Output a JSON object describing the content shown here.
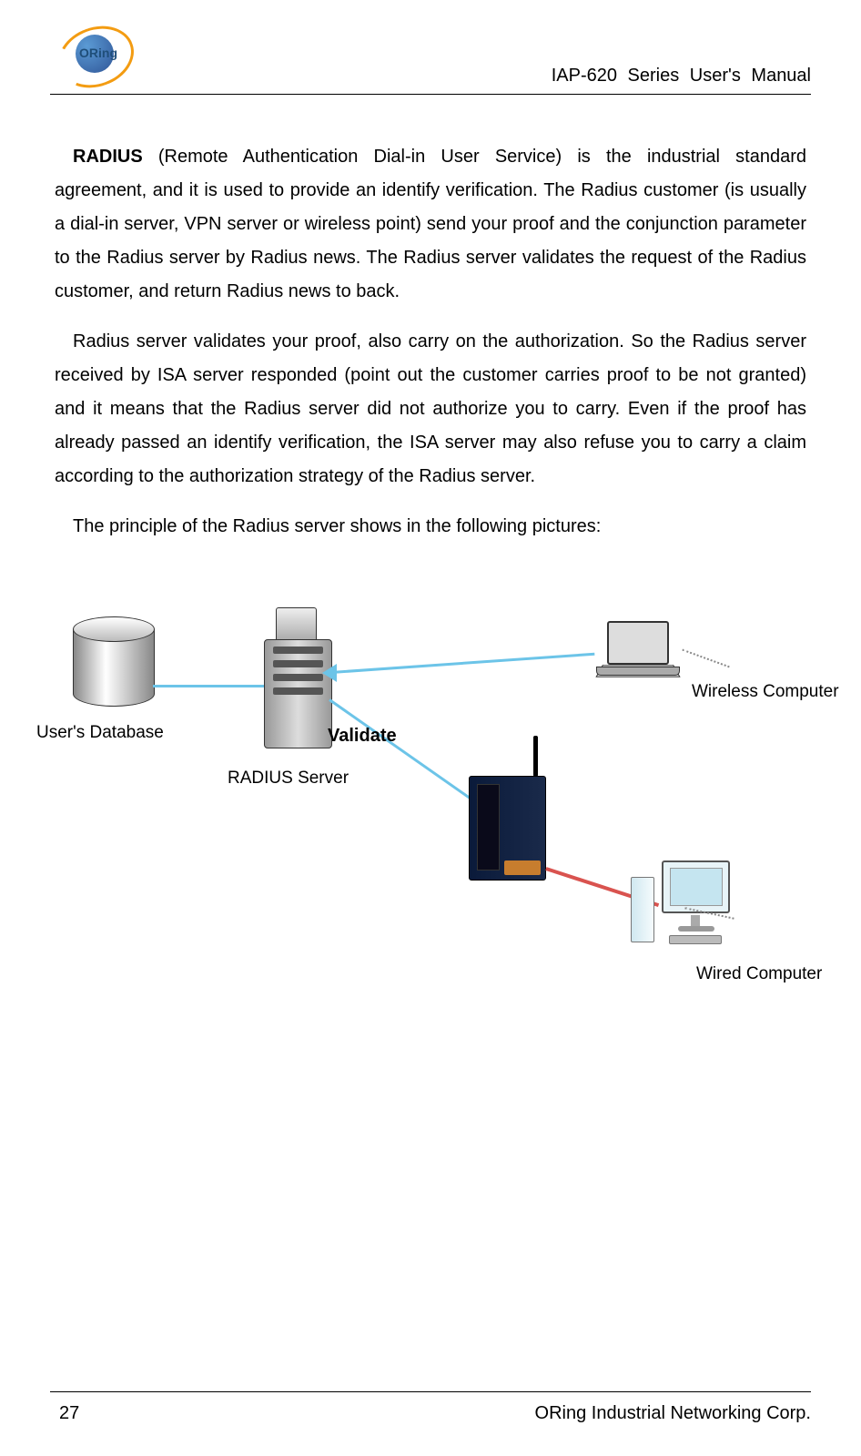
{
  "header": {
    "logo_text": "ORing",
    "title": "IAP-620 Series User's Manual"
  },
  "content": {
    "para1_lead": "RADIUS",
    "para1_rest": " (Remote Authentication Dial-in User Service) is the industrial standard agreement, and it is used to provide an identify verification.   The Radius customer (is usually a dial-in server, VPN server or wireless point) send your proof and the conjunction parameter to the Radius server by Radius news.  The Radius server validates the request of the Radius customer, and return Radius news to back.",
    "para2": "Radius server validates your proof, also carry on the authorization.  So the Radius server received by ISA server responded (point out the customer carries proof to be not granted) and it means that the Radius server did not authorize you to carry.    Even if the proof has already passed an identify verification, the ISA server may also refuse you to carry a claim according to the authorization strategy of the Radius server.",
    "para3": "The principle of the Radius server shows in the following pictures:"
  },
  "diagram": {
    "users_database": "User's Database",
    "radius_server": "RADIUS Server",
    "validate": "Validate",
    "wireless_computer": "Wireless Computer",
    "wired_computer": "Wired Computer"
  },
  "footer": {
    "page": "27",
    "company": "ORing Industrial Networking Corp."
  }
}
